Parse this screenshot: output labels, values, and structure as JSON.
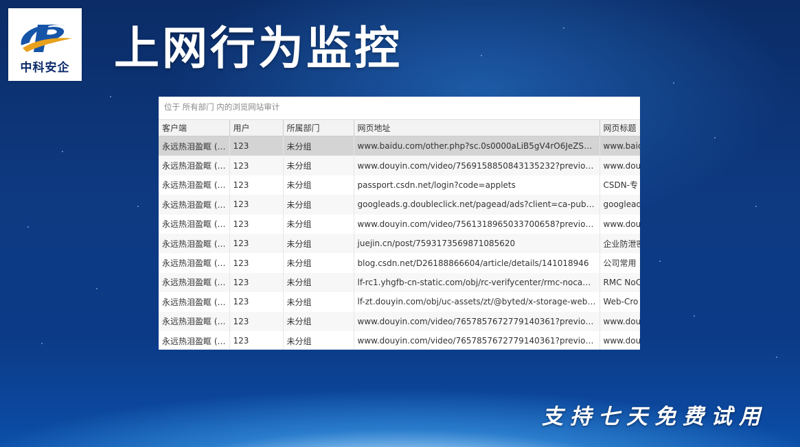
{
  "logo": {
    "text": "中科安企"
  },
  "title": "上网行为监控",
  "panel": {
    "header": "位于 所有部门 内的浏览网站审计",
    "columns": [
      "客户端",
      "用户",
      "所属部门",
      "网页地址",
      "网页标题"
    ],
    "rows": [
      {
        "client": "永远热泪盈眶 (1...",
        "user": "123",
        "dept": "未分组",
        "url": "www.baidu.com/other.php?sc.0s0000aLiB5gV4rO6JeZSBTLR...",
        "title_text": "www.baid"
      },
      {
        "client": "永远热泪盈眶 (1...",
        "user": "123",
        "dept": "未分组",
        "url": "www.douyin.com/video/7569158850843135232?previous_p...",
        "title_text": "www.dou"
      },
      {
        "client": "永远热泪盈眶 (1...",
        "user": "123",
        "dept": "未分组",
        "url": "passport.csdn.net/login?code=applets",
        "title_text": "CSDN-专"
      },
      {
        "client": "永远热泪盈眶 (1...",
        "user": "123",
        "dept": "未分组",
        "url": "googleads.g.doubleclick.net/pagead/ads?client=ca-pub-1...",
        "title_text": "googlead"
      },
      {
        "client": "永远热泪盈眶 (1...",
        "user": "123",
        "dept": "未分组",
        "url": "www.douyin.com/video/7561318965033700658?previous_p...",
        "title_text": "www.dou"
      },
      {
        "client": "永远热泪盈眶 (1...",
        "user": "123",
        "dept": "未分组",
        "url": "juejin.cn/post/7593173569871085620",
        "title_text": "企业防泄密"
      },
      {
        "client": "永远热泪盈眶 (1...",
        "user": "123",
        "dept": "未分组",
        "url": "blog.csdn.net/D26188866604/article/details/141018946",
        "title_text": "公司常用"
      },
      {
        "client": "永远热泪盈眶 (1...",
        "user": "123",
        "dept": "未分组",
        "url": "lf-rc1.yhgfb-cn-static.com/obj/rc-verifycenter/rmc-nocaptc...",
        "title_text": "RMC NoC"
      },
      {
        "client": "永远热泪盈眶 (1...",
        "user": "123",
        "dept": "未分组",
        "url": "lf-zt.douyin.com/obj/uc-assets/zt/@byted/x-storage-web/...",
        "title_text": "Web-Cro"
      },
      {
        "client": "永远热泪盈眶 (1...",
        "user": "123",
        "dept": "未分组",
        "url": "www.douyin.com/video/7657857672779140361?previous_p...",
        "title_text": "www.dou"
      },
      {
        "client": "永远热泪盈眶 (1...",
        "user": "123",
        "dept": "未分组",
        "url": "www.douyin.com/video/7657857672779140361?previous_p...",
        "title_text": "www.dou"
      }
    ]
  },
  "slogan": "支持七天免费试用",
  "colors": {
    "logo_blue": "#1654a8",
    "logo_gold": "#e7a11c",
    "selected_row": "#d4d4d4"
  }
}
